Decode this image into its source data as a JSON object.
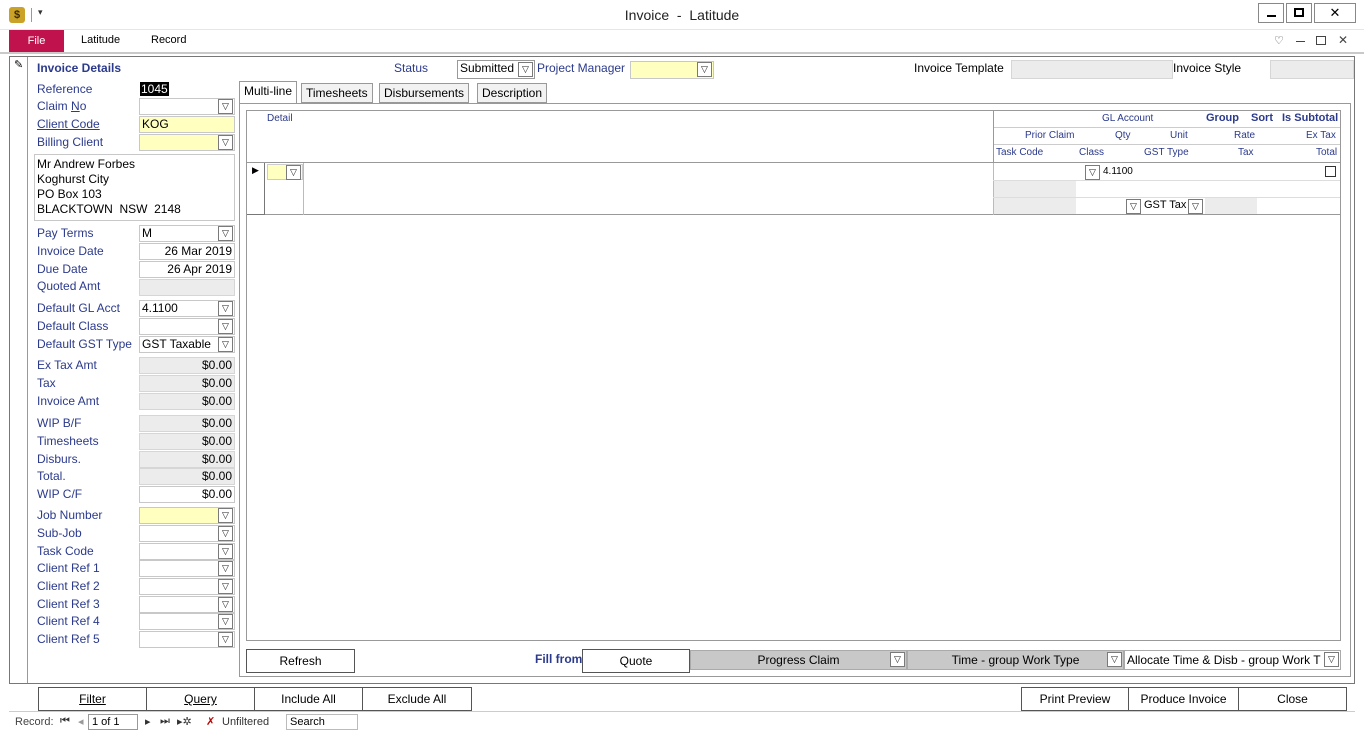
{
  "window": {
    "title": "Invoice  -  Latitude"
  },
  "ribbon": {
    "file": "File",
    "tabs": [
      "Latitude",
      "Record"
    ]
  },
  "header": {
    "status_label": "Status",
    "status_value": "Submitted",
    "pm_label": "Project Manager",
    "template_label": "Invoice Template",
    "style_label": "Invoice Style"
  },
  "details": {
    "title": "Invoice Details",
    "reference_label": "Reference",
    "reference_value": "1045",
    "claim_label_pre": "Claim ",
    "claim_label_u": "N",
    "claim_label_post": "o",
    "client_code_label": "Client Code",
    "client_code_value": "KOG",
    "billing_client_label": "Billing Client",
    "address": [
      "Mr Andrew Forbes",
      "Koghurst City",
      "PO Box 103",
      "BLACKTOWN  NSW  2148"
    ],
    "pay_terms_label": "Pay Terms",
    "pay_terms_value": "M",
    "invoice_date_label": "Invoice Date",
    "invoice_date_value": "26 Mar 2019",
    "due_date_label": "Due Date",
    "due_date_value": "26 Apr 2019",
    "quoted_amt_label": "Quoted Amt",
    "default_gl_label": "Default GL Acct",
    "default_gl_value": "4.1100",
    "default_class_label": "Default Class",
    "default_gst_label": "Default GST Type",
    "default_gst_value": "GST Taxable",
    "ex_tax_label": "Ex Tax Amt",
    "ex_tax_value": "$0.00",
    "tax_label": "Tax",
    "tax_value": "$0.00",
    "invoice_amt_label": "Invoice Amt",
    "invoice_amt_value": "$0.00",
    "wip_bf_label": "WIP B/F",
    "wip_bf_value": "$0.00",
    "timesheets_label": "Timesheets",
    "timesheets_value": "$0.00",
    "disburs_label": "Disburs.",
    "disburs_value": "$0.00",
    "total_label": "Total.",
    "total_value": "$0.00",
    "wip_cf_label": "WIP C/F",
    "wip_cf_value": "$0.00",
    "job_number_label": "Job Number",
    "sub_job_label": "Sub-Job",
    "task_code_label": "Task Code",
    "client_ref_labels": [
      "Client Ref 1",
      "Client Ref 2",
      "Client Ref 3",
      "Client Ref 4",
      "Client Ref 5"
    ]
  },
  "tabs": [
    "Multi-line",
    "Timesheets",
    "Disbursements",
    "Description"
  ],
  "grid": {
    "detail": "Detail",
    "gl_account": "GL Account",
    "group": "Group",
    "sort": "Sort",
    "is_subtotal": "Is Subtotal",
    "prior_claim": "Prior Claim",
    "qty": "Qty",
    "unit": "Unit",
    "rate": "Rate",
    "ex_tax": "Ex Tax",
    "task_code": "Task Code",
    "class": "Class",
    "gst_type": "GST Type",
    "tax": "Tax",
    "total": "Total",
    "row_gl": "4.1100",
    "row_gst": "GST Tax"
  },
  "bottom": {
    "refresh": "Refresh",
    "fill_from": "Fill from",
    "quote": "Quote",
    "progress_claim": "Progress Claim",
    "time_group": "Time - group Work Type",
    "allocate": "Allocate Time & Disb - group Work T"
  },
  "footer": {
    "filter": "Filter",
    "query": "Query",
    "include_all": "Include All",
    "exclude_all": "Exclude All",
    "print_preview": "Print Preview",
    "produce_invoice": "Produce Invoice",
    "close": "Close"
  },
  "nav": {
    "record_label": "Record:",
    "record_value": "1 of 1",
    "filter_state": "Unfiltered",
    "search": "Search"
  },
  "colors": {
    "file_tab": "#c0134e",
    "label_blue": "#2b3a8c",
    "required_yellow": "#ffffc0",
    "readonly_grey": "#ececec"
  }
}
